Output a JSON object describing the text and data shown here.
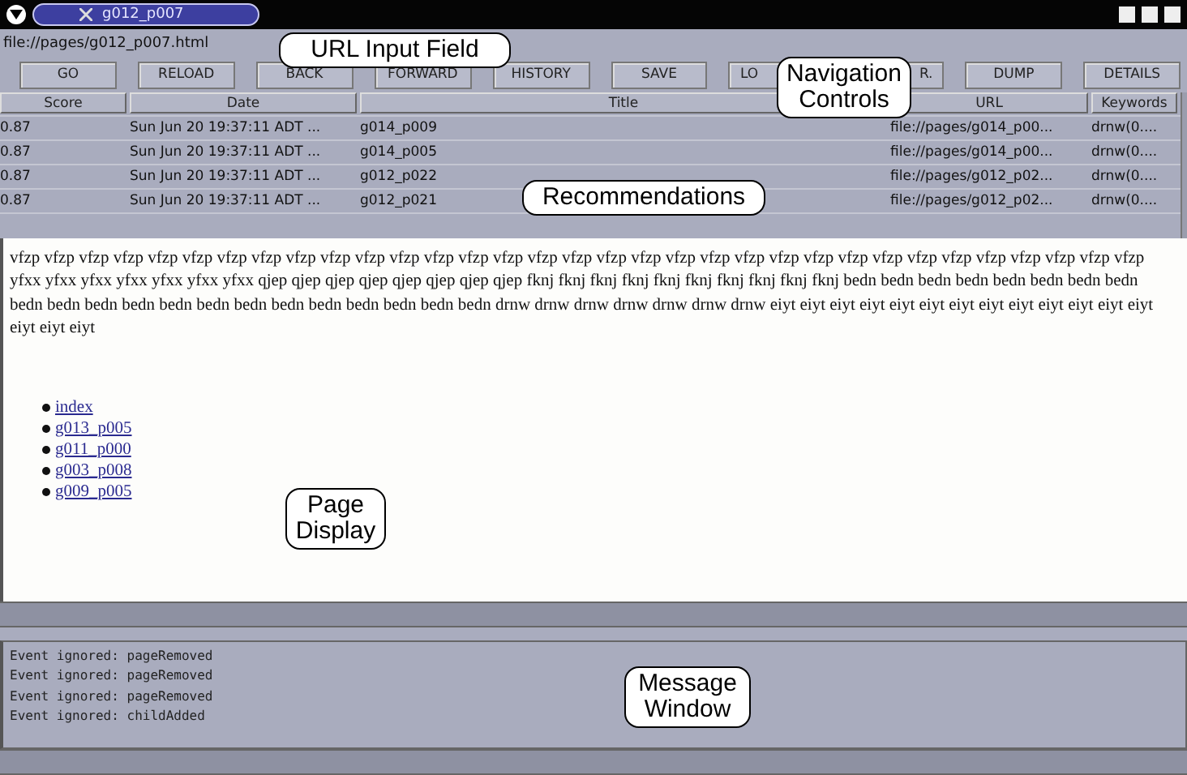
{
  "window": {
    "title": "g012_p007"
  },
  "url": {
    "value": "file://pages/g012_p007.html"
  },
  "buttons": [
    {
      "label": "GO"
    },
    {
      "label": "RELOAD"
    },
    {
      "label": "BACK"
    },
    {
      "label": "FORWARD"
    },
    {
      "label": "HISTORY"
    },
    {
      "label": "SAVE"
    },
    {
      "label": "LO"
    },
    {
      "label": "R."
    },
    {
      "label": "DUMP"
    },
    {
      "label": "DETAILS"
    }
  ],
  "table": {
    "columns": [
      "Score",
      "Date",
      "Title",
      "URL",
      "Keywords"
    ],
    "rows": [
      {
        "cells": [
          "0.87",
          "Sun Jun 20 19:37:11 ADT ...",
          "g014_p009",
          "file://pages/g014_p00...",
          "drnw(0...."
        ]
      },
      {
        "cells": [
          "0.87",
          "Sun Jun 20 19:37:11 ADT ...",
          "g014_p005",
          "file://pages/g014_p00...",
          "drnw(0...."
        ]
      },
      {
        "cells": [
          "0.87",
          "Sun Jun 20 19:37:11 ADT ...",
          "g012_p022",
          "file://pages/g012_p02...",
          "drnw(0...."
        ]
      },
      {
        "cells": [
          "0.87",
          "Sun Jun 20 19:37:11 ADT ...",
          "g012_p021",
          "file://pages/g012_p02...",
          "drnw(0...."
        ]
      }
    ]
  },
  "page": {
    "paragraph": "vfzp vfzp vfzp vfzp vfzp vfzp vfzp vfzp vfzp vfzp vfzp vfzp vfzp vfzp vfzp vfzp vfzp vfzp vfzp vfzp vfzp vfzp vfzp vfzp vfzp vfzp vfzp vfzp vfzp vfzp vfzp vfzp vfzp yfxx yfxx yfxx yfxx yfxx yfxx yfxx qjep qjep qjep qjep qjep qjep qjep qjep fknj fknj fknj fknj fknj fknj fknj fknj fknj fknj bedn bedn bedn bedn bedn bedn bedn bedn bedn bedn bedn bedn bedn bedn bedn bedn bedn bedn bedn bedn bedn drnw drnw drnw drnw drnw drnw drnw eiyt eiyt eiyt eiyt eiyt eiyt eiyt eiyt eiyt eiyt eiyt eiyt eiyt eiyt eiyt eiyt",
    "links": [
      "index",
      "g013_p005",
      "g011_p000",
      "g003_p008",
      "g009_p005"
    ]
  },
  "messages": [
    "Event ignored: pageRemoved",
    "Event ignored: pageRemoved",
    "Event ignored: pageRemoved",
    "Event ignored: childAdded"
  ],
  "callouts": [
    {
      "text": "URL Input Field"
    },
    {
      "text": "Navigation Controls"
    },
    {
      "text": "Recommendations"
    },
    {
      "text": "Page Display"
    },
    {
      "text": "Message Window"
    }
  ]
}
